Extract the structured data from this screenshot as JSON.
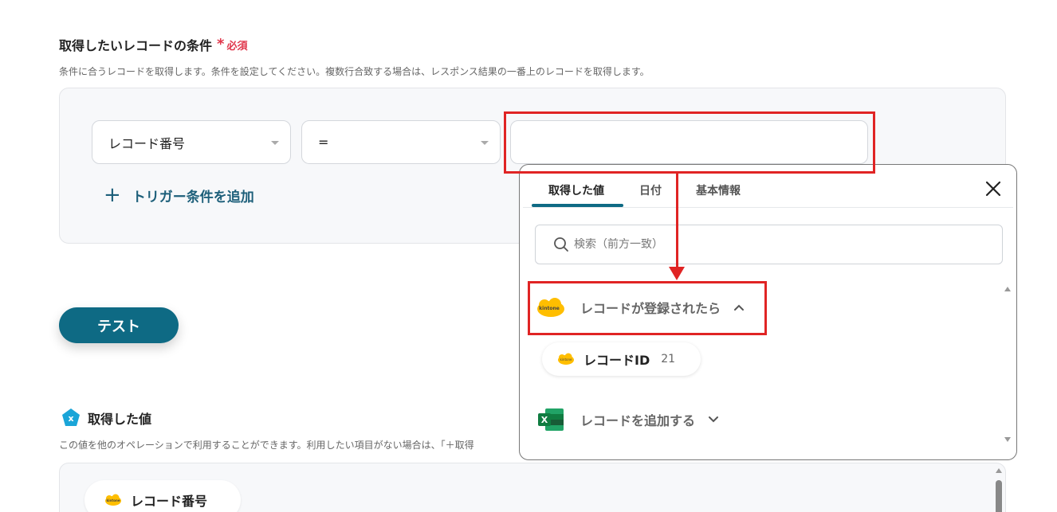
{
  "condition": {
    "title": "取得したいレコードの条件",
    "required": "必須",
    "description": "条件に合うレコードを取得します。条件を設定してください。複数行合致する場合は、レスポンス結果の一番上のレコードを取得します。",
    "field_select": "レコード番号",
    "operator_select": "=",
    "value_input": "",
    "add_trigger": "トリガー条件を追加"
  },
  "test_button": "テスト",
  "acquired": {
    "title": "取得した値",
    "description": "この値を他のオペレーションで利用することができます。利用したい項目がない場合は、「＋取得",
    "chip": "レコード番号"
  },
  "dropdown": {
    "tabs": [
      {
        "label": "取得した値",
        "active": true
      },
      {
        "label": "日付",
        "active": false
      },
      {
        "label": "基本情報",
        "active": false
      }
    ],
    "search_placeholder": "検索（前方一致）",
    "groups": [
      {
        "label": "レコードが登録されたら",
        "icon": "kintone-icon",
        "expanded": true,
        "items": [
          {
            "label": "レコードID",
            "value": "21"
          }
        ]
      },
      {
        "label": "レコードを追加する",
        "icon": "excel-icon",
        "expanded": false
      }
    ]
  },
  "colors": {
    "accent": "#0e6a84",
    "highlight": "#e02424",
    "required": "#e0364b",
    "kintone": "#ffbe00",
    "excel": "#1e7145"
  }
}
